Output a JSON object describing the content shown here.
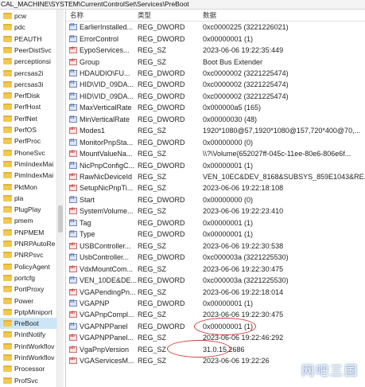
{
  "path": "CAL_MACHINE\\SYSTEM\\CurrentControlSet\\Services\\PreBoot",
  "columns": {
    "name": "名称",
    "type": "类型",
    "data": "数据"
  },
  "tree": [
    {
      "label": "pcw"
    },
    {
      "label": "pdc"
    },
    {
      "label": "PEAUTH"
    },
    {
      "label": "PeerDistSvc"
    },
    {
      "label": "perceptionsi"
    },
    {
      "label": "percsas2i"
    },
    {
      "label": "percsas3i"
    },
    {
      "label": "PerfDisk"
    },
    {
      "label": "PerfHost"
    },
    {
      "label": "PerfNet"
    },
    {
      "label": "PerfOS"
    },
    {
      "label": "PerfProc"
    },
    {
      "label": "PhoneSvc"
    },
    {
      "label": "PimIndexMai"
    },
    {
      "label": "PimIndexMai"
    },
    {
      "label": "PktMon"
    },
    {
      "label": "pla"
    },
    {
      "label": "PlugPlay"
    },
    {
      "label": "pmem"
    },
    {
      "label": "PNPMEM"
    },
    {
      "label": "PNRPAutoRe"
    },
    {
      "label": "PNRPsvc"
    },
    {
      "label": "PolicyAgent"
    },
    {
      "label": "portcfg"
    },
    {
      "label": "PortProxy"
    },
    {
      "label": "Power"
    },
    {
      "label": "PptpMiniport"
    },
    {
      "label": "PreBoot",
      "selected": true
    },
    {
      "label": "PrintNotify"
    },
    {
      "label": "PrintWorkflov"
    },
    {
      "label": "PrintWorkflov"
    },
    {
      "label": "Processor"
    },
    {
      "label": "ProfSvc"
    }
  ],
  "rows": [
    {
      "name": "EarlierInstalled...",
      "type": "REG_DWORD",
      "data": "0xc0000225 (3221226021)",
      "icon": "dword"
    },
    {
      "name": "ErrorControl",
      "type": "REG_DWORD",
      "data": "0x00000001 (1)",
      "icon": "dword"
    },
    {
      "name": "EypoServices...",
      "type": "REG_SZ",
      "data": "2023-06-06 19:22:35:449",
      "icon": "sz"
    },
    {
      "name": "Group",
      "type": "REG_SZ",
      "data": "Boot Bus Extender",
      "icon": "sz"
    },
    {
      "name": "HDAUDIO\\FU...",
      "type": "REG_DWORD",
      "data": "0xc0000002 (3221225474)",
      "icon": "dword"
    },
    {
      "name": "HID\\VID_09DA...",
      "type": "REG_DWORD",
      "data": "0xc0000002 (3221225474)",
      "icon": "dword"
    },
    {
      "name": "HID\\VID_09DA...",
      "type": "REG_DWORD",
      "data": "0xc0000002 (3221225474)",
      "icon": "dword"
    },
    {
      "name": "MaxVerticalRate",
      "type": "REG_DWORD",
      "data": "0x000000a5 (165)",
      "icon": "dword"
    },
    {
      "name": "MinVerticalRate",
      "type": "REG_DWORD",
      "data": "0x00000030 (48)",
      "icon": "dword"
    },
    {
      "name": "Modes1",
      "type": "REG_SZ",
      "data": "1920*1080@57,1920*1080@157,720*400@70,...",
      "icon": "sz"
    },
    {
      "name": "MonitorPnpSta...",
      "type": "REG_DWORD",
      "data": "0x00000000 (0)",
      "icon": "dword"
    },
    {
      "name": "MountValueNa...",
      "type": "REG_SZ",
      "data": "\\\\?\\Volume{652027ff-045c-11ee-80e6-806e6f...",
      "icon": "sz"
    },
    {
      "name": "NicPnpConfigC...",
      "type": "REG_DWORD",
      "data": "0x00000001 (1)",
      "icon": "dword"
    },
    {
      "name": "RawNicDeviceId",
      "type": "REG_SZ",
      "data": "VEN_10EC&DEV_8168&SUBSYS_859E1043&RE...",
      "icon": "sz"
    },
    {
      "name": "SetupNicPnpTi...",
      "type": "REG_SZ",
      "data": "2023-06-06 19:22:18:108",
      "icon": "sz"
    },
    {
      "name": "Start",
      "type": "REG_DWORD",
      "data": "0x00000000 (0)",
      "icon": "dword"
    },
    {
      "name": "SystemVolume...",
      "type": "REG_SZ",
      "data": "2023-06-06 19:22:23:410",
      "icon": "sz"
    },
    {
      "name": "Tag",
      "type": "REG_DWORD",
      "data": "0x00000001 (1)",
      "icon": "dword"
    },
    {
      "name": "Type",
      "type": "REG_DWORD",
      "data": "0x00000001 (1)",
      "icon": "dword"
    },
    {
      "name": "USBController...",
      "type": "REG_SZ",
      "data": "2023-06-06 19:22:30:538",
      "icon": "sz"
    },
    {
      "name": "UsbController...",
      "type": "REG_DWORD",
      "data": "0xc000003a (3221225530)",
      "icon": "dword"
    },
    {
      "name": "VdxMountCom...",
      "type": "REG_SZ",
      "data": "2023-06-06 19:22:30:475",
      "icon": "sz"
    },
    {
      "name": "VEN_10DE&DE...",
      "type": "REG_DWORD",
      "data": "0xc000003a (3221225530)",
      "icon": "dword"
    },
    {
      "name": "VGAPendingPn...",
      "type": "REG_SZ",
      "data": "2023-06-06 19:22:18:014",
      "icon": "sz"
    },
    {
      "name": "VGAPNP",
      "type": "REG_DWORD",
      "data": "0x00000001 (1)",
      "icon": "dword"
    },
    {
      "name": "VGAPnpCompl...",
      "type": "REG_SZ",
      "data": "2023-06-06 19:22:30:475",
      "icon": "sz"
    },
    {
      "name": "VGAPNPPanel",
      "type": "REG_DWORD",
      "data": "0x00000001 (1)",
      "icon": "dword"
    },
    {
      "name": "VGAPNPPanel...",
      "type": "REG_SZ",
      "data": "2023-06-06 19:22:46:292",
      "icon": "sz"
    },
    {
      "name": "VgaPnpVersion",
      "type": "REG_SZ",
      "data": "31.0.15.2686",
      "icon": "sz"
    },
    {
      "name": "VGAServicesM...",
      "type": "REG_SZ",
      "data": "2023-06-06 19:22:26",
      "icon": "sz"
    }
  ],
  "watermark": "网吧三国",
  "accent_colors": {
    "selection": "#cde6f7",
    "annotation": "#d23a3a"
  }
}
